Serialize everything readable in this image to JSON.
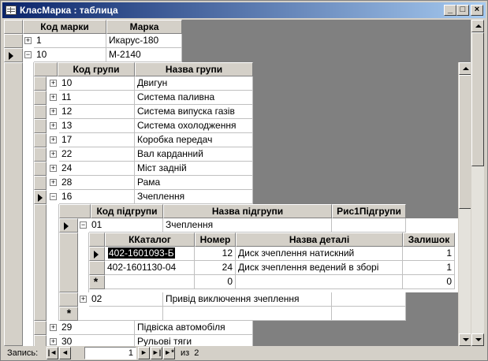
{
  "window": {
    "title": "КласМарка : таблица",
    "minimize_glyph": "_",
    "maximize_glyph": "□",
    "close_glyph": "×",
    "title_color": "#0a246a"
  },
  "level1": {
    "headers": [
      "Код марки",
      "Марка"
    ],
    "rows": [
      {
        "code": "1",
        "name": "Икарус-180"
      },
      {
        "code": "10",
        "name": "М-2140"
      }
    ]
  },
  "level2": {
    "headers": [
      "Код групи",
      "Назва групи"
    ],
    "rows": [
      {
        "code": "10",
        "name": "Двигун"
      },
      {
        "code": "11",
        "name": "Система паливна"
      },
      {
        "code": "12",
        "name": "Система випуска газів"
      },
      {
        "code": "13",
        "name": "Система охолодження"
      },
      {
        "code": "17",
        "name": "Коробка передач"
      },
      {
        "code": "22",
        "name": "Вал карданний"
      },
      {
        "code": "24",
        "name": "Міст задній"
      },
      {
        "code": "28",
        "name": "Рама"
      },
      {
        "code": "16",
        "name": "Зчеплення"
      }
    ],
    "after_rows": [
      {
        "code": "29",
        "name": "Підвіска автомобіля"
      },
      {
        "code": "30",
        "name": "Рульові тяги"
      }
    ]
  },
  "level3": {
    "headers": [
      "Код підгрупи",
      "Назва підгрупи",
      "Рис1Підгрупи"
    ],
    "rows": [
      {
        "code": "01",
        "name": "Зчеплення",
        "pic": ""
      },
      {
        "code": "02",
        "name": "Привід виключення зчеплення",
        "pic": ""
      }
    ]
  },
  "level4": {
    "headers": [
      "ККаталог",
      "Номер",
      "Назва деталі",
      "Залишок"
    ],
    "rows": [
      {
        "catalog": "402-1601093-Б",
        "number": "12",
        "name": "Диск зчеплення натискний",
        "rest": "1"
      },
      {
        "catalog": "402-1601130-04",
        "number": "24",
        "name": "Диск зчеплення ведений в зборі",
        "rest": "1"
      }
    ],
    "new_row": {
      "number": "0",
      "rest": "0"
    }
  },
  "statusbar": {
    "label": "Запись:",
    "current_record": "1",
    "of_text": "из  2",
    "first_glyph": "|◄",
    "prev_glyph": "◄",
    "next_glyph": "►",
    "last_glyph": "►|",
    "new_glyph": "►*"
  }
}
